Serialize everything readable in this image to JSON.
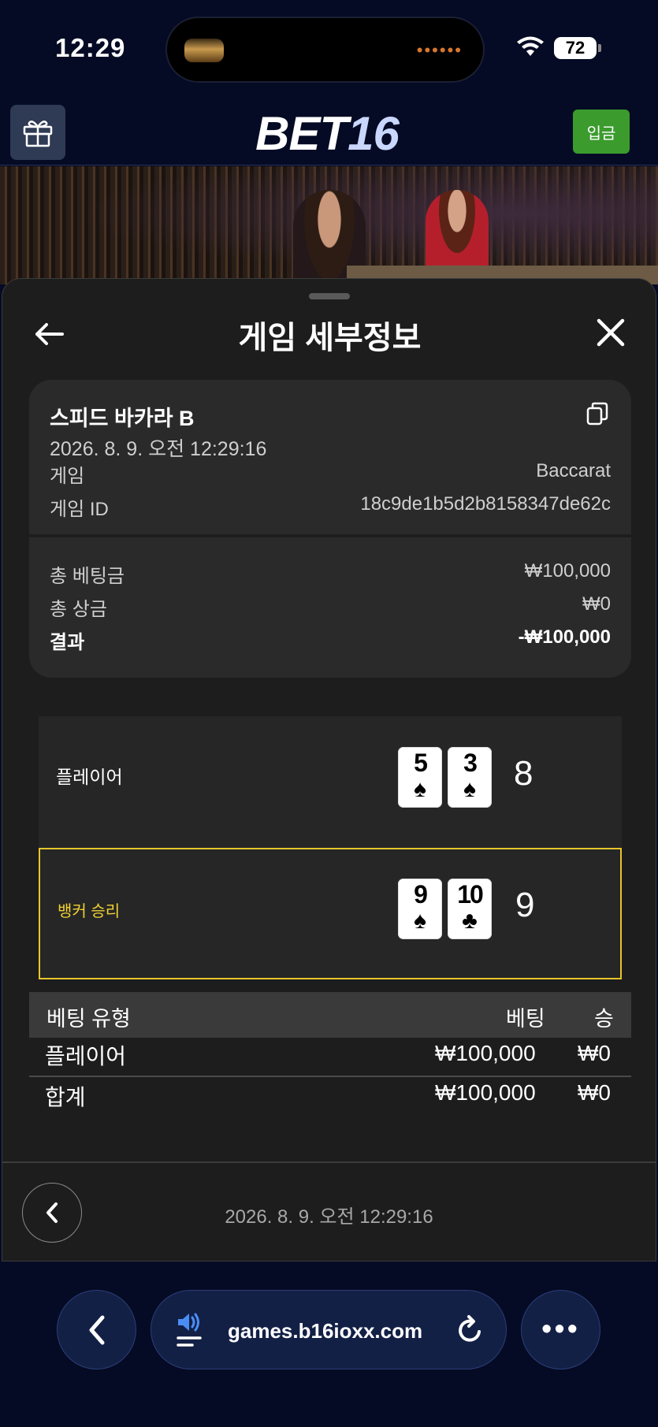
{
  "status_bar": {
    "time": "12:29",
    "battery": "72"
  },
  "header": {
    "logo_part1": "BET",
    "logo_part2": "16",
    "deposit_label": "입금"
  },
  "sheet": {
    "title": "게임 세부정보",
    "game": {
      "name": "스피드 바카라 B",
      "datetime": "2026. 8. 9. 오전 12:29:16",
      "type_label": "게임",
      "type_value": "Baccarat",
      "id_label": "게임 ID",
      "id_value": "18c9de1b5d2b8158347de62c"
    },
    "summary": {
      "total_bet_label": "총 베팅금",
      "total_bet_value": "₩100,000",
      "total_win_label": "총 상금",
      "total_win_value": "₩0",
      "result_label": "결과",
      "result_value": "-₩100,000"
    },
    "hands": [
      {
        "label": "플레이어",
        "cards": [
          {
            "rank": "5",
            "suit": "♠"
          },
          {
            "rank": "3",
            "suit": "♠"
          }
        ],
        "score": "8"
      },
      {
        "label": "뱅커 승리",
        "cards": [
          {
            "rank": "9",
            "suit": "♠"
          },
          {
            "rank": "10",
            "suit": "♣"
          }
        ],
        "score": "9"
      }
    ],
    "bets": {
      "headers": {
        "type": "베팅 유형",
        "bet": "베팅",
        "win": "승"
      },
      "rows": [
        {
          "type": "플레이어",
          "bet": "₩100,000",
          "win": "₩0"
        }
      ],
      "total": {
        "type": "합계",
        "bet": "₩100,000",
        "win": "₩0"
      }
    },
    "footer": {
      "datetime": "2026. 8. 9. 오전 12:29:16"
    }
  },
  "browser": {
    "url": "games.b16ioxx.com"
  },
  "colors": {
    "accent_green": "#3b9b2d",
    "winner_gold": "#e7c52a",
    "background": "#050b24",
    "sheet": "#1d1d1d"
  }
}
